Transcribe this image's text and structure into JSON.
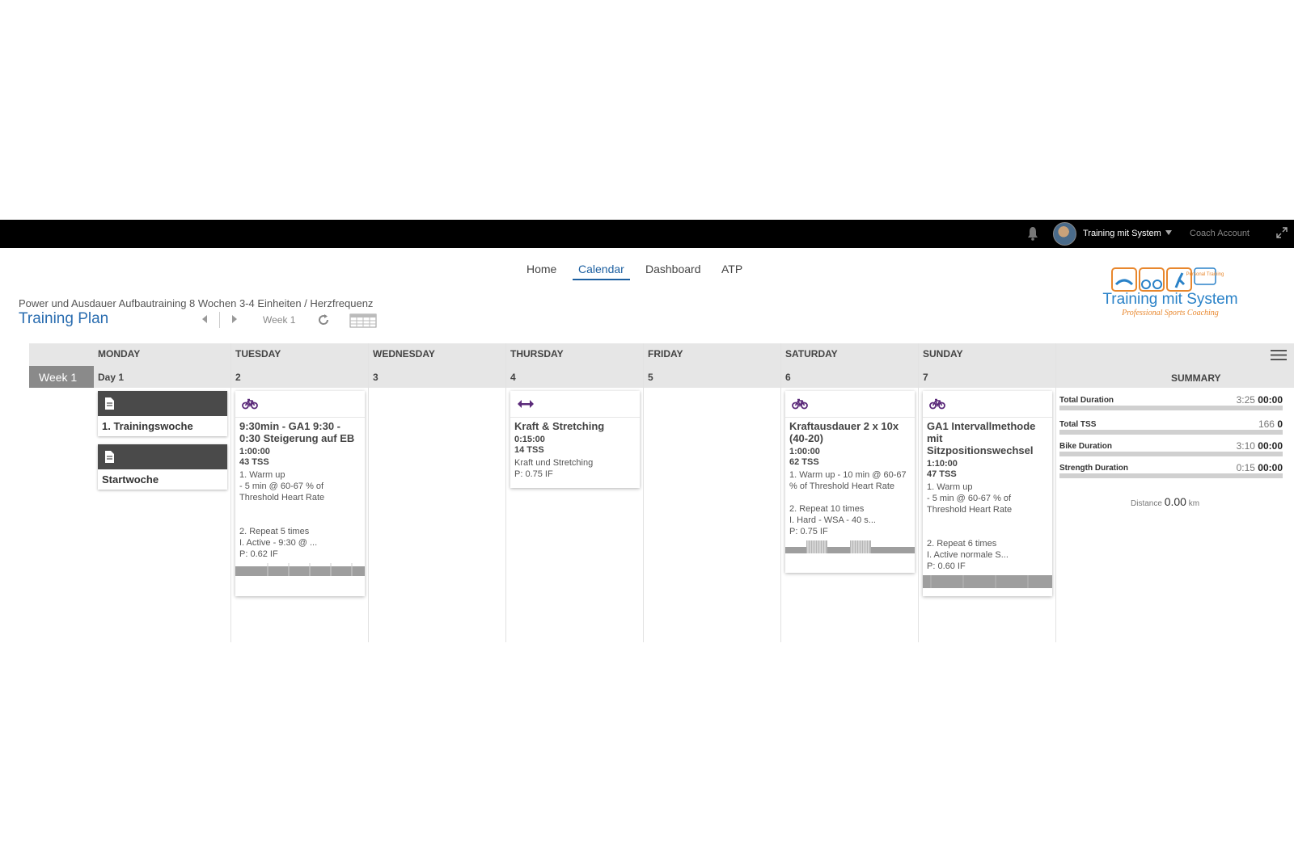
{
  "topbar": {
    "user_name": "Training mit System",
    "coach_label": "Coach Account"
  },
  "nav": {
    "items": [
      "Home",
      "Calendar",
      "Dashboard",
      "ATP"
    ],
    "active": "Calendar"
  },
  "plan": {
    "subtitle": "Power und Ausdauer Aufbautraining 8 Wochen 3-4 Einheiten / Herzfrequenz",
    "title": "Training Plan",
    "week_label": "Week 1"
  },
  "logo": {
    "name": "Training mit System",
    "tagline": "Professional Sports Coaching",
    "badge": "Personal Training"
  },
  "calendar": {
    "week": "Week 1",
    "days": [
      {
        "name": "MONDAY",
        "num": "Day 1"
      },
      {
        "name": "TUESDAY",
        "num": "2"
      },
      {
        "name": "WEDNESDAY",
        "num": "3"
      },
      {
        "name": "THURSDAY",
        "num": "4"
      },
      {
        "name": "FRIDAY",
        "num": "5"
      },
      {
        "name": "SATURDAY",
        "num": "6"
      },
      {
        "name": "SUNDAY",
        "num": "7"
      }
    ],
    "notes": [
      {
        "text": "1. Trainingswoche"
      },
      {
        "text": "Startwoche"
      }
    ],
    "workouts": [
      {
        "icon": "bike-icon",
        "title": "9:30min - GA1 9:30 - 0:30 Steigerung auf EB",
        "duration": "1:00:00",
        "tss": "43 TSS",
        "desc": "1. Warm up\n- 5 min @ 60-67 % of Threshold Heart Rate\n\n\n2. Repeat 5 times\nI. Active - 9:30 @ ...",
        "if": "P: 0.62 IF"
      },
      {
        "icon": "dumbbell-icon",
        "title": "Kraft & Stretching",
        "duration": "0:15:00",
        "tss": "14 TSS",
        "desc": "Kraft und Stretching",
        "if": "P: 0.75 IF"
      },
      {
        "icon": "bike-icon",
        "title": "Kraftausdauer 2 x 10x (40-20)",
        "duration": "1:00:00",
        "tss": "62 TSS",
        "desc": "1. Warm up - 10 min @ 60-67 % of Threshold Heart Rate\n\n2. Repeat 10 times\nI. Hard - WSA - 40 s...",
        "if": "P: 0.75 IF"
      },
      {
        "icon": "bike-icon",
        "title": "GA1 Intervallmethode mit Sitzpositionswechsel",
        "duration": "1:10:00",
        "tss": "47 TSS",
        "desc": "1. Warm up\n- 5 min @ 60-67 % of Threshold Heart Rate\n\n\n2. Repeat 6 times\nI. Active normale S...",
        "if": "P: 0.60 IF"
      }
    ]
  },
  "summary": {
    "title": "SUMMARY",
    "rows": [
      {
        "label": "Total Duration",
        "planned": "3:25",
        "actual": "00:00"
      },
      {
        "label": "Total TSS",
        "planned": "166",
        "actual": "0"
      },
      {
        "label": "Bike Duration",
        "planned": "3:10",
        "actual": "00:00"
      },
      {
        "label": "Strength Duration",
        "planned": "0:15",
        "actual": "00:00"
      }
    ],
    "distance_label": "Distance",
    "distance_value": "0.00",
    "distance_unit": "km"
  },
  "colors": {
    "accent": "#2a6db0",
    "sport_icon": "#5b2a7a",
    "header_band": "#e6e6e6"
  }
}
